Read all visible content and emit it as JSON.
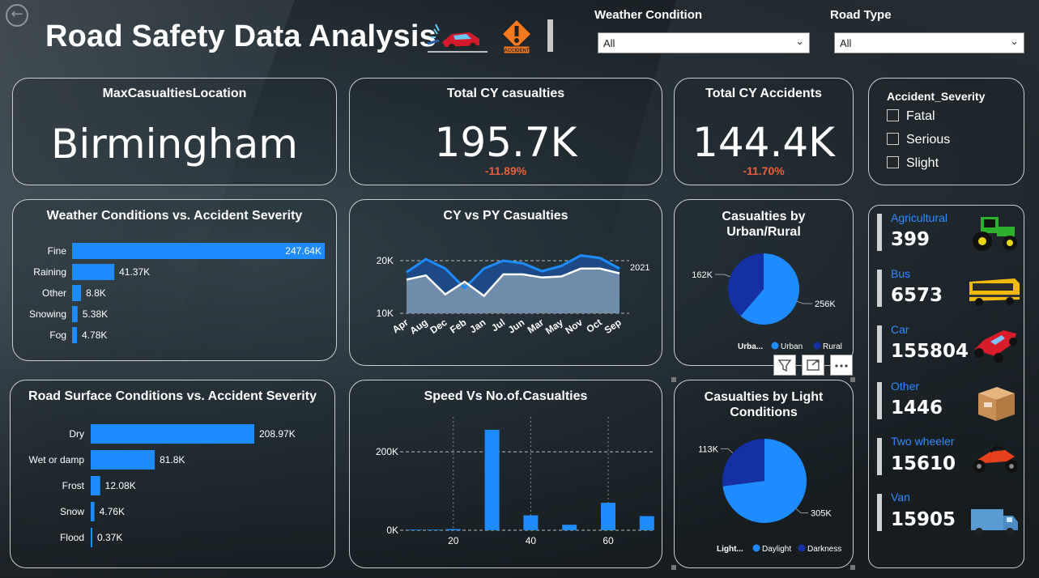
{
  "header": {
    "title": "Road Safety Data Analysis",
    "logo2_text": "ACCIDENT",
    "weather_label": "Weather Condition",
    "weather_value": "All",
    "road_label": "Road Type",
    "road_value": "All"
  },
  "kpis": {
    "location": {
      "title": "MaxCasualtiesLocation",
      "value": "Birmingham"
    },
    "casualties": {
      "title": "Total CY casualties",
      "value": "195.7K",
      "delta": "-11.89%"
    },
    "accidents": {
      "title": "Total CY Accidents",
      "value": "144.4K",
      "delta": "-11.70%"
    }
  },
  "severity": {
    "title": "Accident_Severity",
    "options": [
      "Fatal",
      "Serious",
      "Slight"
    ]
  },
  "vehicles": [
    {
      "name": "Agricultural",
      "value": "399",
      "icon": "tractor-icon"
    },
    {
      "name": "Bus",
      "value": "6573",
      "icon": "bus-icon"
    },
    {
      "name": "Car",
      "value": "155804",
      "icon": "car-icon"
    },
    {
      "name": "Other",
      "value": "1446",
      "icon": "box-icon"
    },
    {
      "name": "Two wheeler",
      "value": "15610",
      "icon": "motorcycle-icon"
    },
    {
      "name": "Van",
      "value": "15905",
      "icon": "van-icon"
    }
  ],
  "colors": {
    "accent": "#1e8cff",
    "dark_series": "#1530a3",
    "delta": "#e8603c"
  },
  "chart_data": [
    {
      "type": "bar",
      "orientation": "horizontal",
      "title": "Weather Conditions vs. Accident Severity",
      "categories": [
        "Fine",
        "Raining",
        "Other",
        "Snowing",
        "Fog"
      ],
      "values": [
        247.64,
        41.37,
        8.8,
        5.38,
        4.78
      ],
      "labels": [
        "247.64K",
        "41.37K",
        "8.8K",
        "5.38K",
        "4.78K"
      ],
      "xlim": [
        0,
        247.64
      ]
    },
    {
      "type": "area",
      "title": "CY vs PY Casualties",
      "categories": [
        "Apr",
        "Aug",
        "Dec",
        "Feb",
        "Jan",
        "Jul",
        "Jun",
        "Mar",
        "May",
        "Nov",
        "Oct",
        "Sep"
      ],
      "series": [
        {
          "values": [
            17800,
            20300,
            18500,
            14800,
            18500,
            20000,
            19500,
            18000,
            19000,
            21000,
            20500,
            18500
          ]
        },
        {
          "name": "2021",
          "values": [
            16400,
            17200,
            13600,
            16000,
            13300,
            17400,
            17400,
            16800,
            17000,
            18500,
            18500,
            17600
          ]
        }
      ],
      "ytick_labels": [
        "10K",
        "20K"
      ],
      "ylim": [
        10000,
        20000
      ],
      "xlabel": "",
      "ylabel": ""
    },
    {
      "type": "pie",
      "title": "Casualties by Urban/Rural",
      "legend_title": "Urba...",
      "slices": [
        {
          "name": "Urban",
          "value": 256,
          "label": "256K"
        },
        {
          "name": "Rural",
          "value": 162,
          "label": "162K"
        }
      ]
    },
    {
      "type": "bar",
      "orientation": "horizontal",
      "title": "Road Surface Conditions vs. Accident Severity",
      "categories": [
        "Dry",
        "Wet or damp",
        "Frost",
        "Snow",
        "Flood"
      ],
      "values": [
        208.97,
        81.8,
        12.08,
        4.76,
        0.37
      ],
      "labels": [
        "208.97K",
        "81.8K",
        "12.08K",
        "4.76K",
        "0.37K"
      ],
      "xlim": [
        0,
        208.97
      ]
    },
    {
      "type": "bar",
      "title": "Speed Vs No.of.Casualties",
      "x": [
        10,
        15,
        20,
        30,
        40,
        50,
        60,
        70
      ],
      "values": [
        1.5,
        1.5,
        3,
        256,
        38,
        14,
        70,
        36
      ],
      "unit": "K",
      "xtick_labels": [
        "20",
        "40",
        "60"
      ],
      "ytick_labels": [
        "0K",
        "200K"
      ],
      "ylim": [
        0,
        260
      ],
      "xlabel": "",
      "ylabel": ""
    },
    {
      "type": "pie",
      "title": "Casualties by Light Conditions",
      "legend_title": "Light...",
      "slices": [
        {
          "name": "Daylight",
          "value": 305,
          "label": "305K"
        },
        {
          "name": "Darkness",
          "value": 113,
          "label": "113K"
        }
      ]
    }
  ]
}
